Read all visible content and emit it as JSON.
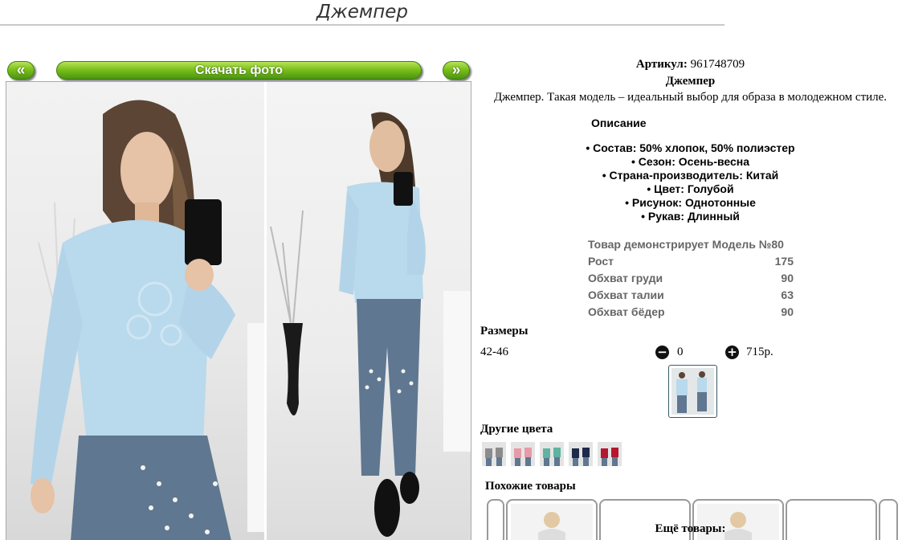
{
  "page": {
    "title": "Джемпер"
  },
  "gallery": {
    "prev_label": "«",
    "next_label": "»",
    "download_label": "Скачать фото"
  },
  "product": {
    "sku_label": "Артикул:",
    "sku_value": "961748709",
    "name": "Джемпер",
    "description": "Джемпер. Такая модель – идеальный выбор для образа в молодежном стиле."
  },
  "description": {
    "heading": "Описание",
    "properties": [
      "• Состав: 50% хлопок, 50% полиэстер",
      "• Сезон: Осень-весна",
      "• Страна-производитель: Китай",
      "• Цвет: Голубой",
      "• Рисунок: Однотонные",
      "• Рукав: Длинный"
    ]
  },
  "model": {
    "heading": "Товар демонстрирует Модель №80",
    "rows": [
      {
        "label": "Рост",
        "value": "175"
      },
      {
        "label": "Обхват груди",
        "value": "90"
      },
      {
        "label": "Обхват талии",
        "value": "63"
      },
      {
        "label": "Обхват бёдер",
        "value": "90"
      }
    ]
  },
  "sizes": {
    "heading": "Размеры",
    "items": [
      {
        "size": "42-46",
        "quantity": "0",
        "minus": "−",
        "plus": "+",
        "price": "715р."
      }
    ]
  },
  "other_colors": {
    "heading": "Другие цвета",
    "swatches": [
      {
        "color": "#8c8c8c"
      },
      {
        "color": "#e79aa8"
      },
      {
        "color": "#5fb3a0"
      },
      {
        "color": "#1e2a4a"
      },
      {
        "color": "#b5172f"
      }
    ]
  },
  "similar": {
    "heading": "Похожие товары"
  },
  "more": {
    "heading": "Ещё товары:"
  },
  "colors": {
    "accent_green": "#7cc01b",
    "sweater_blue": "#b9d9ec",
    "jeans_blue": "#5f7790"
  }
}
